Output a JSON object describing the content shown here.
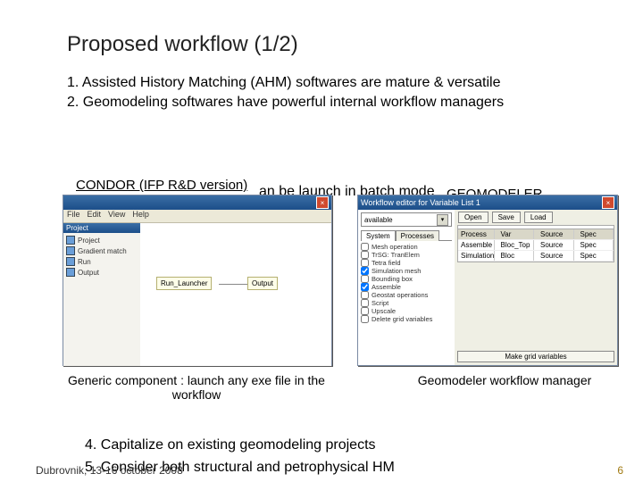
{
  "title": "Proposed workflow (1/2)",
  "body": {
    "p1": "1. Assisted History Matching (AHM) softwares are mature & versatile",
    "p2": "2. Geomodeling softwares have powerful internal workflow managers",
    "overlap": "an be launch in batch mode"
  },
  "labels": {
    "condor": "CONDOR (IFP R&D version)",
    "geomodeler": "GEOMODELER"
  },
  "captions": {
    "left": "Generic component : launch any exe file in the workflow",
    "right": "Geomodeler workflow manager"
  },
  "foot": {
    "l4": "4. Capitalize on existing geomodeling projects",
    "l5": "5. Consider both structural and petrophysical HM",
    "date": "Dubrovnik, 13-16 october 2008",
    "page": "6"
  },
  "win_left": {
    "menus": [
      "File",
      "Edit",
      "View",
      "Help"
    ],
    "side_hdr": "Project",
    "side_items": [
      "Project",
      "Gradient match",
      "Run",
      "Output"
    ],
    "node1": "Run_Launcher",
    "node2": "Output"
  },
  "win_right": {
    "title": "Workflow editor for Variable List 1",
    "available": "available",
    "tab1": "System",
    "tab2": "Processes",
    "items": [
      "Mesh operation",
      "TrSG: TranElem",
      "Tetra field",
      "Simulation mesh",
      "Bounding box",
      "Assemble",
      "Geostat operations",
      "Script",
      "Upscale",
      "Delete grid variables"
    ],
    "btn_open": "Open",
    "btn_save": "Save",
    "btn_load": "Load",
    "grid_hdr": [
      "Process",
      "Var",
      "Source",
      "Spec"
    ],
    "grid_r1": [
      "Assemble stack",
      "Bloc_Top",
      "Source",
      "Spec"
    ],
    "grid_r2": [
      "Simulation mesh",
      "Bloc",
      "Source",
      "Spec"
    ],
    "btn_run": "Make grid variables"
  }
}
